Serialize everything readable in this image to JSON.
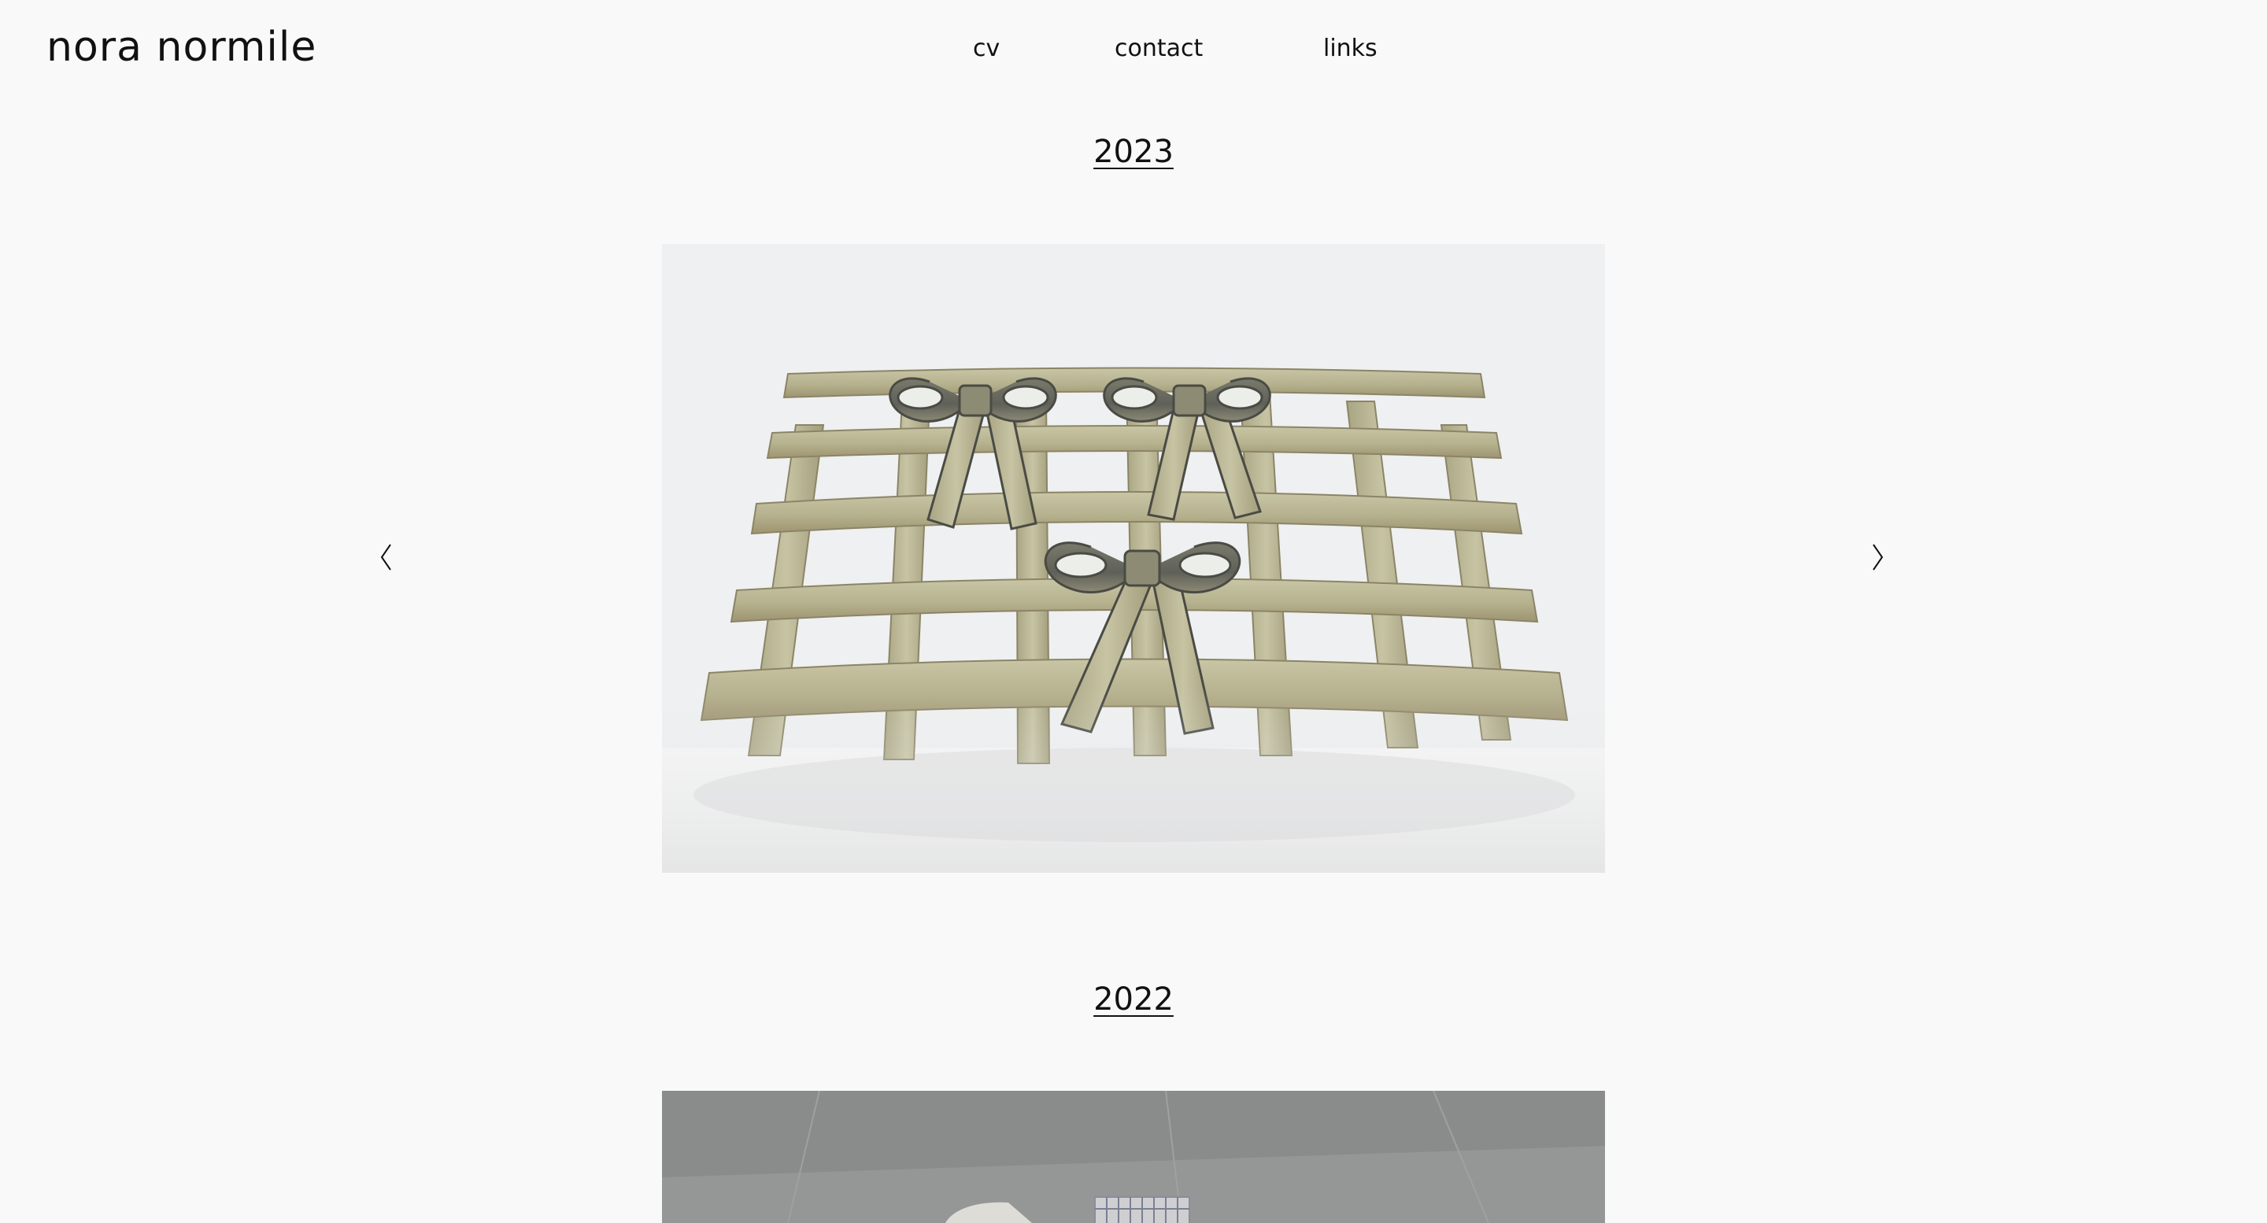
{
  "site": {
    "title": "nora normile"
  },
  "nav": {
    "items": [
      {
        "label": "cv"
      },
      {
        "label": "contact"
      },
      {
        "label": "links"
      }
    ]
  },
  "gallery": {
    "sections": [
      {
        "year": "2023"
      },
      {
        "year": "2022"
      }
    ],
    "prev_icon": "chevron-left-icon",
    "next_icon": "chevron-right-icon"
  }
}
